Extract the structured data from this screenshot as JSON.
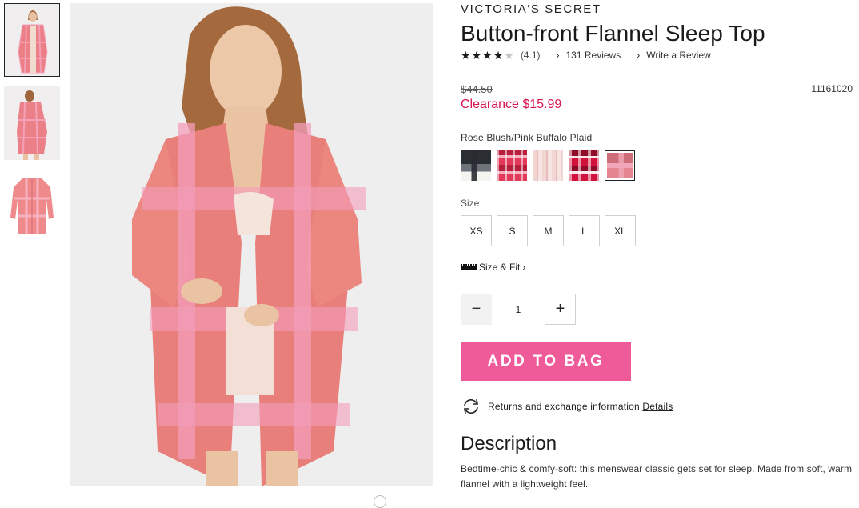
{
  "product": {
    "brand": "VICTORIA'S SECRET",
    "title": "Button-front Flannel Sleep Top",
    "rating": 4.1,
    "rating_display": "(4.1)",
    "reviews_link": "131 Reviews",
    "write_review_link": "Write a Review",
    "original_price": "$44.50",
    "sale_price": "Clearance $15.99",
    "sku": "11161020"
  },
  "colors": {
    "selected_label": "Rose Blush/Pink Buffalo Plaid",
    "swatches": [
      {
        "name": "black-white-plaid",
        "colors": [
          "#2b2f33",
          "#f4f4f0",
          "#8c9096"
        ]
      },
      {
        "name": "red-pink-plaid",
        "colors": [
          "#e33a5b",
          "#f9d3dc",
          "#b81f3d"
        ]
      },
      {
        "name": "blush-stripe",
        "colors": [
          "#f2d6d4",
          "#e8c0bf",
          "#f7e4e2"
        ]
      },
      {
        "name": "red-white-plaid",
        "colors": [
          "#d0123c",
          "#f8e6e9",
          "#8f0d2a"
        ]
      },
      {
        "name": "rose-blush-pink-buffalo-plaid",
        "colors": [
          "#e3848f",
          "#f1a7b8",
          "#cd6d77"
        ],
        "selected": true
      }
    ]
  },
  "sizes": {
    "label": "Size",
    "options": [
      "XS",
      "S",
      "M",
      "L",
      "XL"
    ]
  },
  "fit": {
    "label": "Size & Fit",
    "chevron": "›"
  },
  "quantity": {
    "value": "1",
    "minus": "−",
    "plus": "+"
  },
  "cart": {
    "add_label": "ADD TO BAG",
    "color": "#ef5a98"
  },
  "returns": {
    "text": "Returns and exchange information.",
    "link": "Details"
  },
  "description": {
    "heading": "Description",
    "body": "Bedtime-chic & comfy-soft: this menswear classic gets set for sleep. Made from soft, warm flannel with a lightweight feel."
  },
  "stars": {
    "full": "★",
    "empty": "★",
    "chevron": "›"
  },
  "gallery": {
    "images": [
      "front-view",
      "back-view",
      "flat-lay"
    ],
    "active_index": 0
  }
}
